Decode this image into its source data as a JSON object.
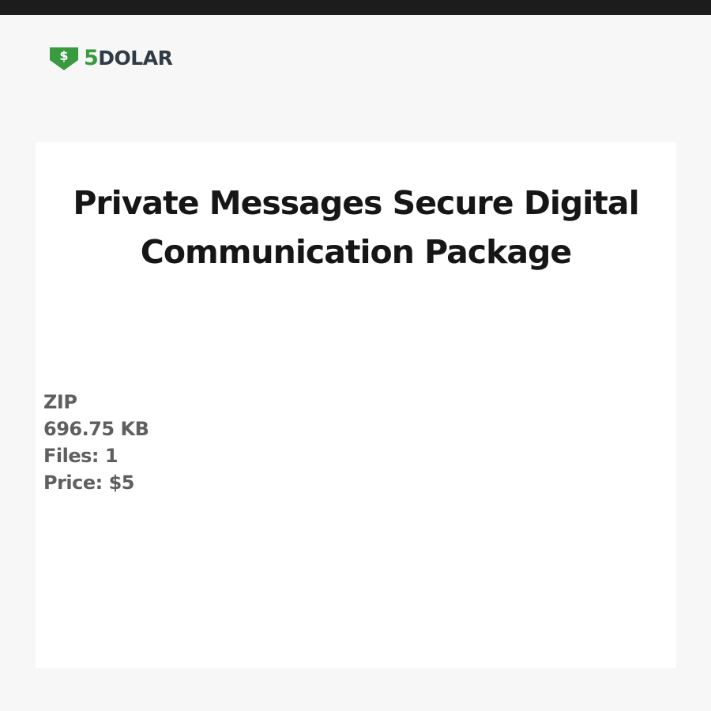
{
  "brand": {
    "five": "5",
    "word": "DOLAR",
    "shield_symbol": "$",
    "icon": "dollar-shield-icon",
    "colors": {
      "green": "#3a9a3f",
      "dark": "#2f3b45"
    }
  },
  "product": {
    "title": "Private Messages Secure Digital Communication Package",
    "format": "ZIP",
    "size": "696.75 KB",
    "files": "Files: 1",
    "price": "Price: $5"
  }
}
